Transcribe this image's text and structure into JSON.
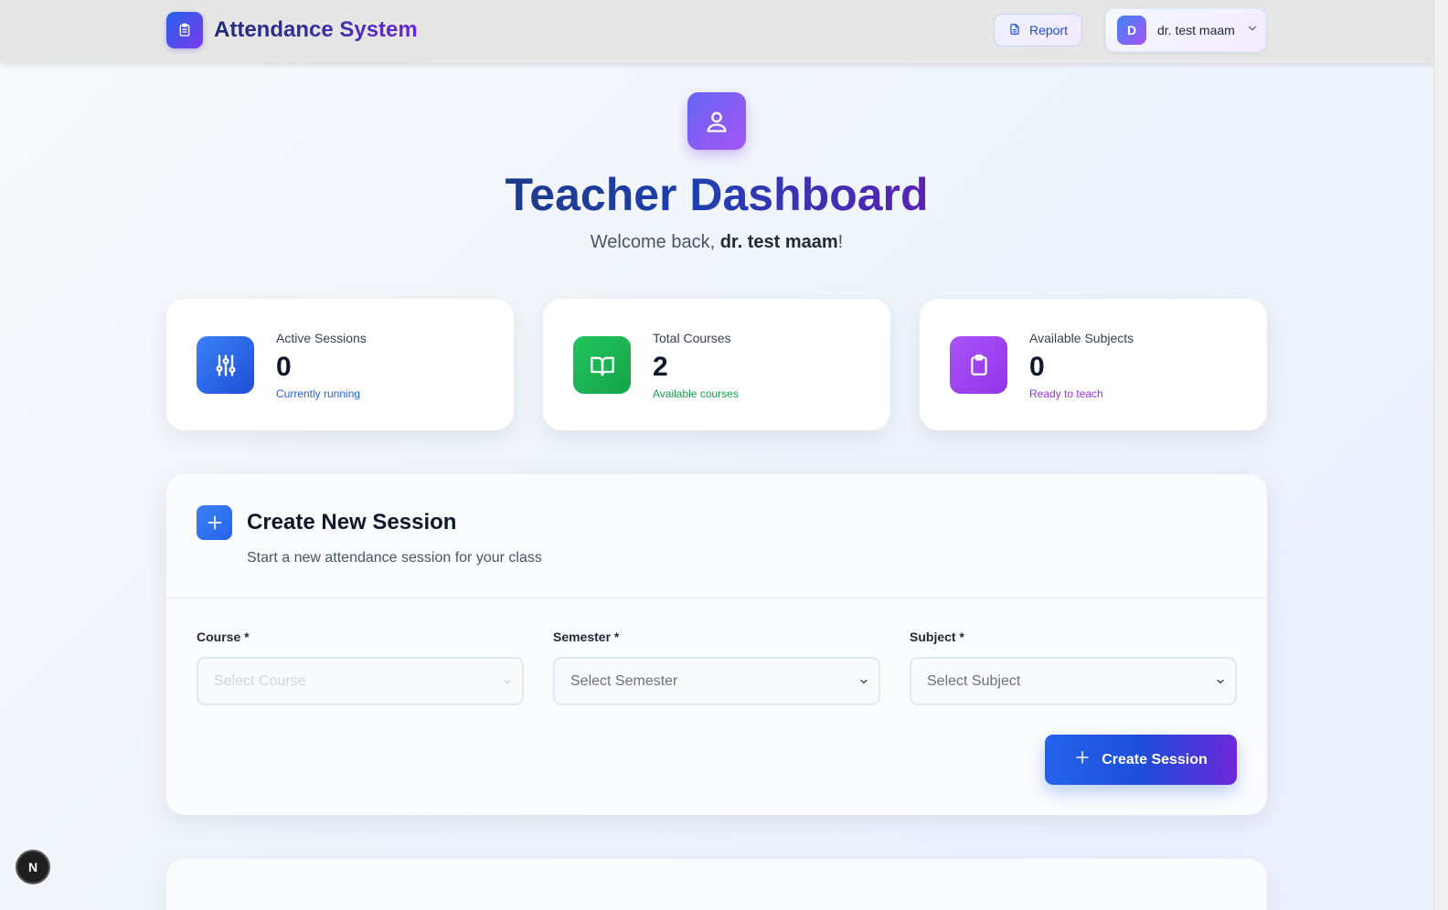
{
  "navbar": {
    "brand": "Attendance System",
    "report_label": "Report",
    "user_initial": "D",
    "user_name": "dr. test maam"
  },
  "hero": {
    "title": "Teacher Dashboard",
    "welcome_prefix": "Welcome back, ",
    "welcome_name": "dr. test maam",
    "welcome_suffix": "!"
  },
  "stats": [
    {
      "label": "Active Sessions",
      "value": "0",
      "sub": "Currently running",
      "icon": "sliders-icon",
      "color": "#2563eb"
    },
    {
      "label": "Total Courses",
      "value": "2",
      "sub": "Available courses",
      "icon": "book-icon",
      "color": "#16a34a"
    },
    {
      "label": "Available Subjects",
      "value": "0",
      "sub": "Ready to teach",
      "icon": "clipboard-icon",
      "color": "#9333ea"
    }
  ],
  "create_session": {
    "title": "Create New Session",
    "description": "Start a new attendance session for your class",
    "fields": [
      {
        "label": "Course *",
        "placeholder": "Select Course"
      },
      {
        "label": "Semester *",
        "placeholder": "Select Semester"
      },
      {
        "label": "Subject *",
        "placeholder": "Select Subject"
      }
    ],
    "button_label": "Create Session"
  },
  "dev_badge": "N"
}
